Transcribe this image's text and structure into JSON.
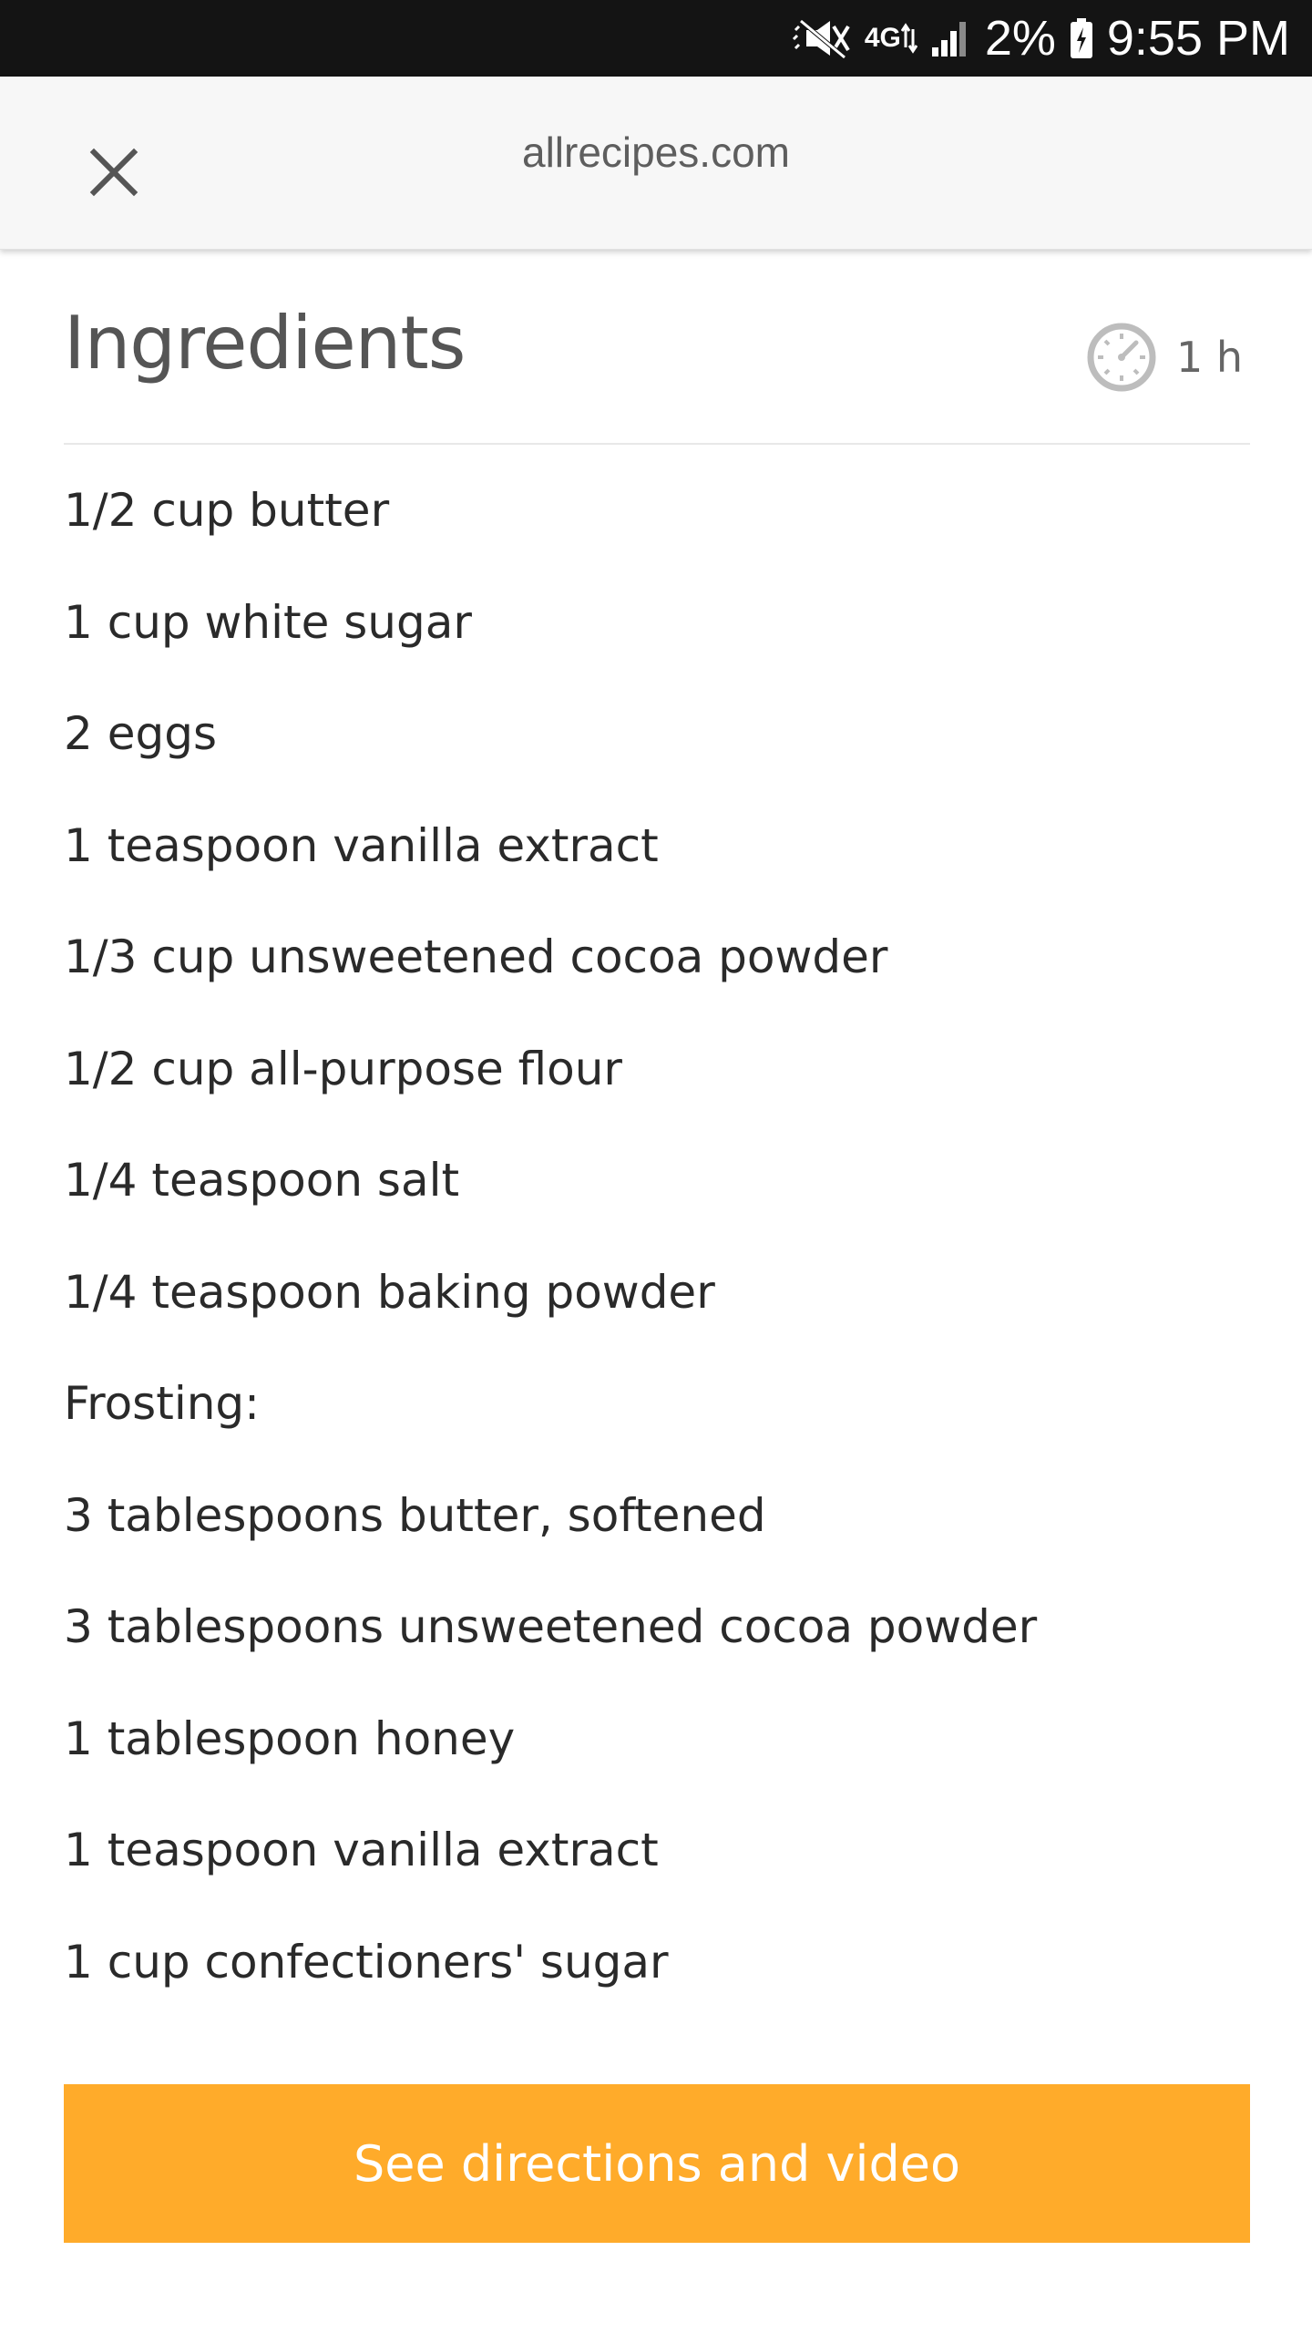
{
  "status_bar": {
    "network": "4G",
    "battery_percent": "2%",
    "time": "9:55 PM",
    "icons": [
      "mute-icon",
      "network-4g-icon",
      "signal-icon",
      "battery-icon"
    ]
  },
  "header": {
    "domain": "allrecipes.com",
    "close_icon": "close-icon"
  },
  "ingredients": {
    "title": "Ingredients",
    "time": "1 h",
    "time_icon": "timer-icon",
    "items": [
      "1/2 cup butter",
      "1 cup white sugar",
      "2 eggs",
      "1 teaspoon vanilla extract",
      "1/3 cup unsweetened cocoa powder",
      "1/2 cup all-purpose flour",
      "1/4 teaspoon salt",
      "1/4 teaspoon baking powder",
      "Frosting:",
      "3 tablespoons butter, softened",
      "3 tablespoons unsweetened cocoa powder",
      "1 tablespoon honey",
      "1 teaspoon vanilla extract",
      "1 cup confectioners' sugar"
    ]
  },
  "cta": {
    "label": "See directions and video"
  },
  "colors": {
    "status_bar_bg": "#141414",
    "header_bg": "#f7f7f7",
    "accent": "#ffab2a",
    "text": "#2a2a2a"
  }
}
